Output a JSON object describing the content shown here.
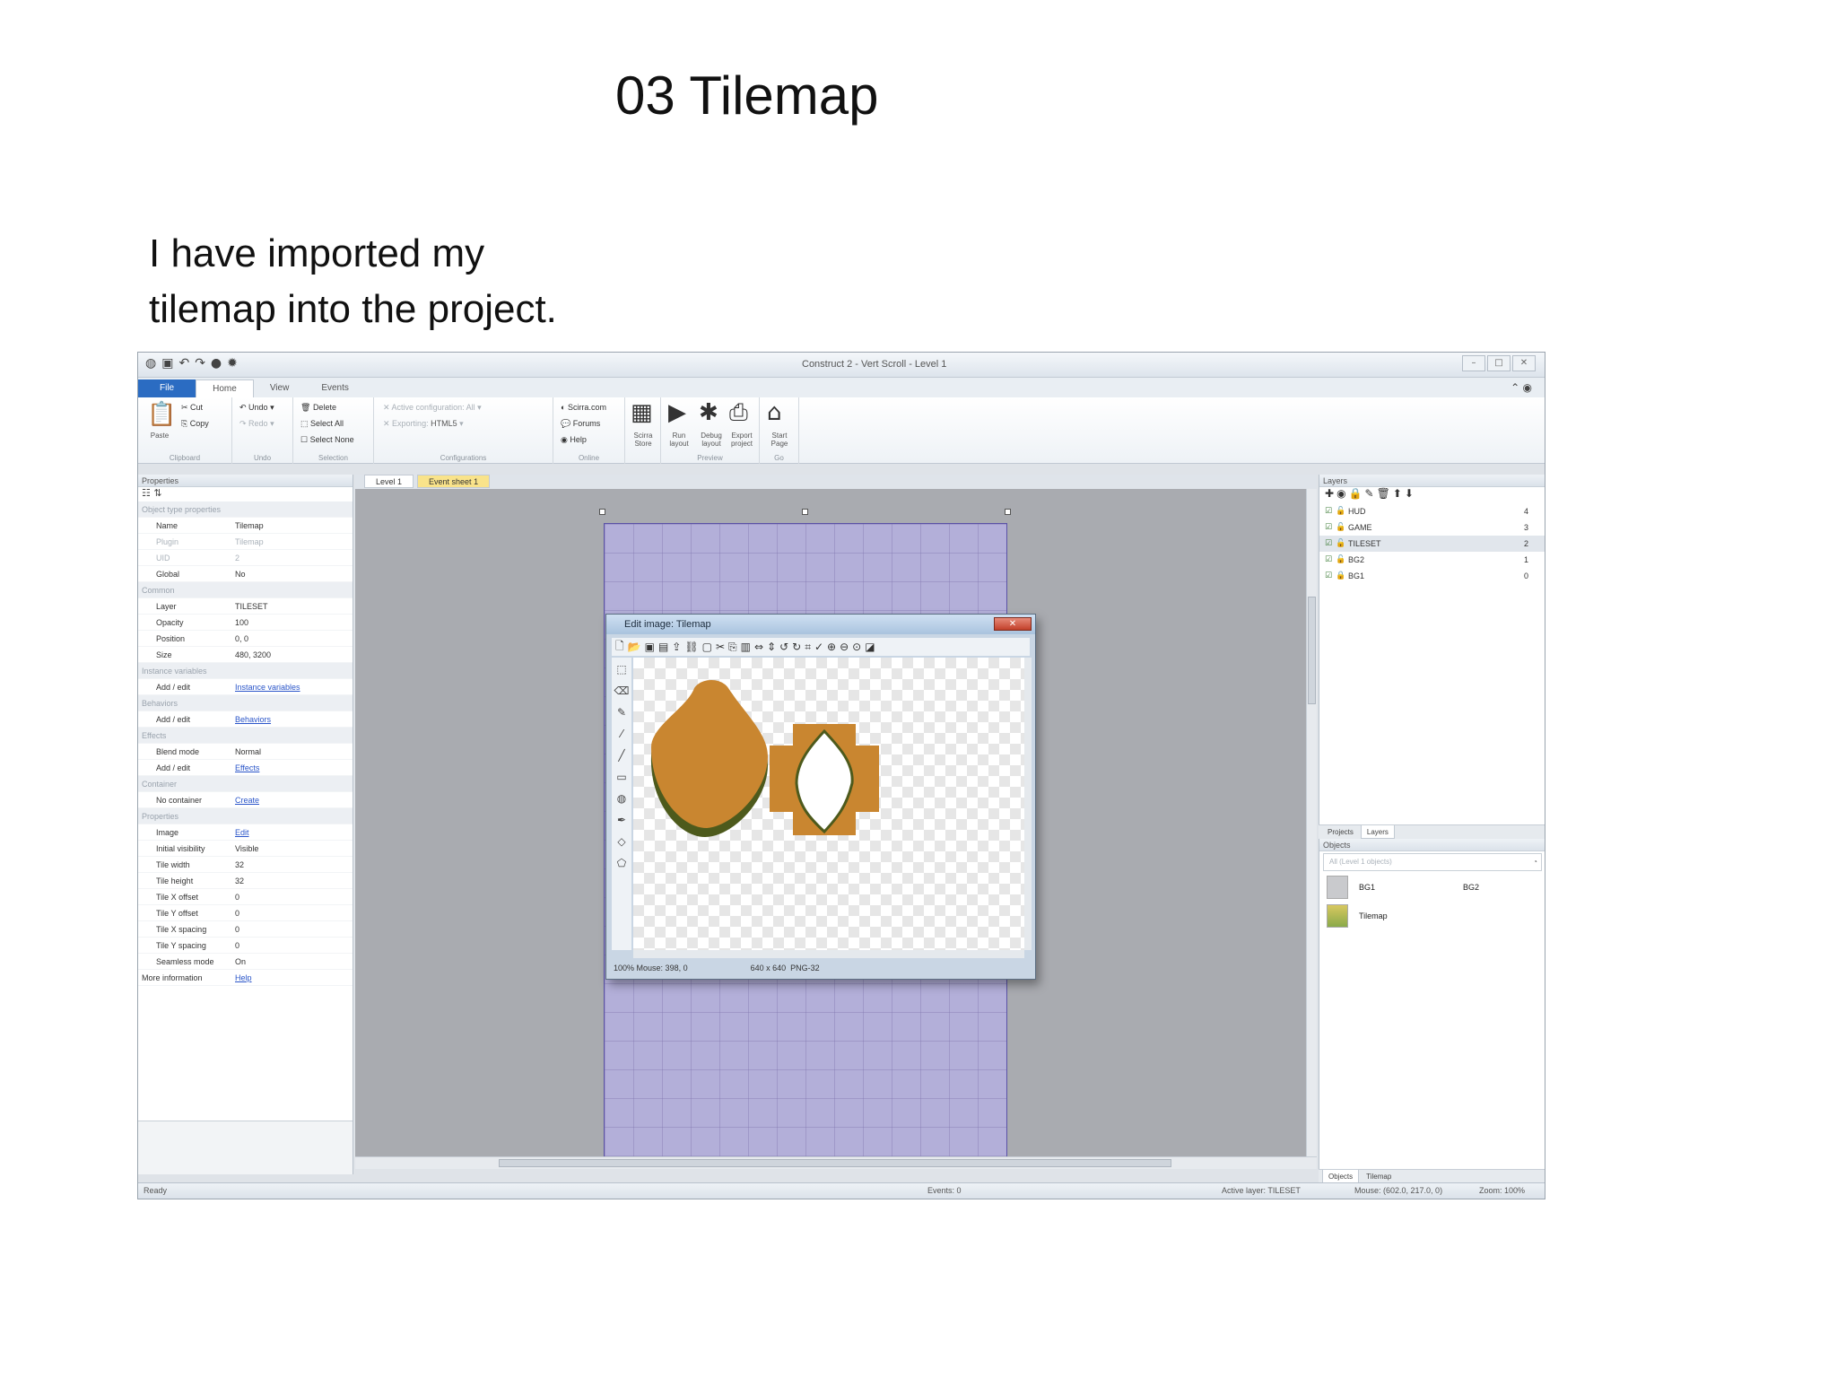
{
  "slide": {
    "title": "03 Tilemap",
    "body_line1": "I have imported my",
    "body_line2": "tilemap into the project."
  },
  "app": {
    "window_title": "Construct 2 - Vert Scroll - Level 1",
    "ribbon_tabs": [
      "File",
      "Home",
      "View",
      "Events"
    ],
    "ribbon": {
      "clipboard": {
        "paste": "Paste",
        "cut": "Cut",
        "copy": "Copy",
        "label": "Clipboard"
      },
      "undo": {
        "undo": "Undo",
        "redo": "Redo",
        "label": "Undo"
      },
      "selection": {
        "delete": "Delete",
        "select_all": "Select All",
        "select_none": "Select None",
        "label": "Selection"
      },
      "configurations": {
        "active": "Active configuration: All",
        "exporting": "Exporting:",
        "exporting_value": "HTML5",
        "label": "Configurations"
      },
      "online": {
        "scirra": "Scirra.com",
        "forums": "Forums",
        "help": "Help",
        "label": "Online"
      },
      "store": "Scirra Store",
      "preview": {
        "run": "Run layout",
        "debug": "Debug layout",
        "export": "Export project",
        "label": "Preview"
      },
      "go": {
        "start": "Start Page",
        "label": "Go"
      }
    },
    "properties": {
      "header": "Properties",
      "rows": [
        {
          "type": "section",
          "key": "Object type properties"
        },
        {
          "key": "Name",
          "value": "Tilemap"
        },
        {
          "key": "Plugin",
          "value": "Tilemap",
          "dim": true
        },
        {
          "key": "UID",
          "value": "2",
          "dim": true
        },
        {
          "key": "Global",
          "value": "No"
        },
        {
          "type": "section",
          "key": "Common"
        },
        {
          "key": "Layer",
          "value": "TILESET"
        },
        {
          "key": "Opacity",
          "value": "100"
        },
        {
          "key": "Position",
          "value": "0, 0"
        },
        {
          "key": "Size",
          "value": "480, 3200"
        },
        {
          "type": "section",
          "key": "Instance variables"
        },
        {
          "key": "Add / edit",
          "value": "Instance variables",
          "link": true
        },
        {
          "type": "section",
          "key": "Behaviors"
        },
        {
          "key": "Add / edit",
          "value": "Behaviors",
          "link": true
        },
        {
          "type": "section",
          "key": "Effects"
        },
        {
          "key": "Blend mode",
          "value": "Normal"
        },
        {
          "key": "Add / edit",
          "value": "Effects",
          "link": true
        },
        {
          "type": "section",
          "key": "Container"
        },
        {
          "key": "No container",
          "value": "Create",
          "link": true
        },
        {
          "type": "section",
          "key": "Properties"
        },
        {
          "key": "Image",
          "value": "Edit",
          "link": true
        },
        {
          "key": "Initial visibility",
          "value": "Visible"
        },
        {
          "key": "Tile width",
          "value": "32"
        },
        {
          "key": "Tile height",
          "value": "32"
        },
        {
          "key": "Tile X offset",
          "value": "0"
        },
        {
          "key": "Tile Y offset",
          "value": "0"
        },
        {
          "key": "Tile X spacing",
          "value": "0"
        },
        {
          "key": "Tile Y spacing",
          "value": "0"
        },
        {
          "key": "Seamless mode",
          "value": "On"
        },
        {
          "key": "More information",
          "value": "Help",
          "link": true,
          "top": true
        }
      ]
    },
    "doc_tabs": [
      "Level 1",
      "Event sheet 1"
    ],
    "dialog": {
      "title": "Edit image: Tilemap",
      "status_zoom": "100%",
      "status_mouse": "Mouse: 398, 0",
      "status_size": "640 x 640",
      "status_format": "PNG-32"
    },
    "layers": {
      "header": "Layers",
      "items": [
        {
          "name": "HUD",
          "index": "4",
          "locked": false
        },
        {
          "name": "GAME",
          "index": "3",
          "locked": false
        },
        {
          "name": "TILESET",
          "index": "2",
          "locked": false,
          "selected": true
        },
        {
          "name": "BG2",
          "index": "1",
          "locked": false
        },
        {
          "name": "BG1",
          "index": "0",
          "locked": true
        }
      ],
      "tabs": [
        "Projects",
        "Layers"
      ]
    },
    "objects": {
      "header": "Objects",
      "search_placeholder": "All (Level 1 objects)",
      "items": [
        {
          "name": "BG1",
          "right": "BG2"
        },
        {
          "name": "Tilemap"
        }
      ],
      "tabs": [
        "Objects",
        "Tilemap"
      ]
    },
    "status": {
      "ready": "Ready",
      "events": "Events: 0",
      "active_layer": "Active layer: TILESET",
      "mouse": "Mouse: (602.0, 217.0, 0)",
      "zoom": "Zoom: 100%"
    },
    "colors": {
      "file_tab": "#2b6cc2",
      "layout_bg": "#b3afd9",
      "tile_orange": "#c98630",
      "tile_green": "#4d5a1c"
    }
  }
}
